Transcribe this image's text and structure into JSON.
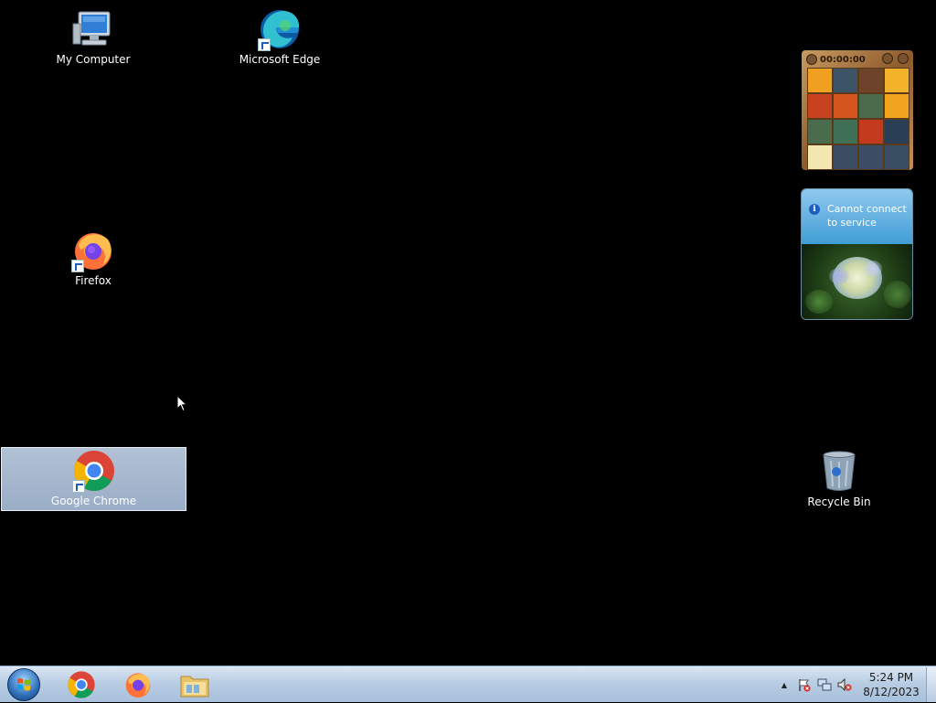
{
  "desktop": {
    "icons": [
      {
        "label": "My Computer",
        "icon": "computer-icon"
      },
      {
        "label": "Microsoft Edge",
        "icon": "edge-icon"
      },
      {
        "label": "Firefox",
        "icon": "firefox-icon"
      },
      {
        "label": "Google Chrome",
        "icon": "chrome-icon",
        "selected": true
      },
      {
        "label": "Recycle Bin",
        "icon": "recycle-bin-icon"
      }
    ]
  },
  "gadgets": {
    "puzzle": {
      "timer": "00:00:00",
      "tile_colors": [
        "#f0a020",
        "#3d5366",
        "#6d4429",
        "#f2b22a",
        "#c9421f",
        "#d4561e",
        "#4a6b4c",
        "#f1a51f",
        "#4a6b4c",
        "#3f6f55",
        "#c33a1f",
        "#2a3e55",
        "#f4e6b0",
        "#3a4d63",
        "#3b4e66",
        "#3a4e63"
      ]
    },
    "weather": {
      "message": "Cannot connect to service",
      "info_glyph": "i"
    }
  },
  "taskbar": {
    "pinned": [
      {
        "name": "chrome",
        "icon": "chrome-icon"
      },
      {
        "name": "firefox",
        "icon": "firefox-icon"
      },
      {
        "name": "explorer",
        "icon": "folder-icon"
      }
    ],
    "tray": {
      "chevron": "▲",
      "icons": [
        "action-center-flag-icon",
        "network-icon",
        "volume-muted-icon"
      ]
    },
    "clock": {
      "time": "5:24 PM",
      "date": "8/12/2023"
    }
  },
  "colors": {
    "desktop_bg": "#000000",
    "selection": "#b9cde3",
    "taskbar": "#b9cde3"
  }
}
